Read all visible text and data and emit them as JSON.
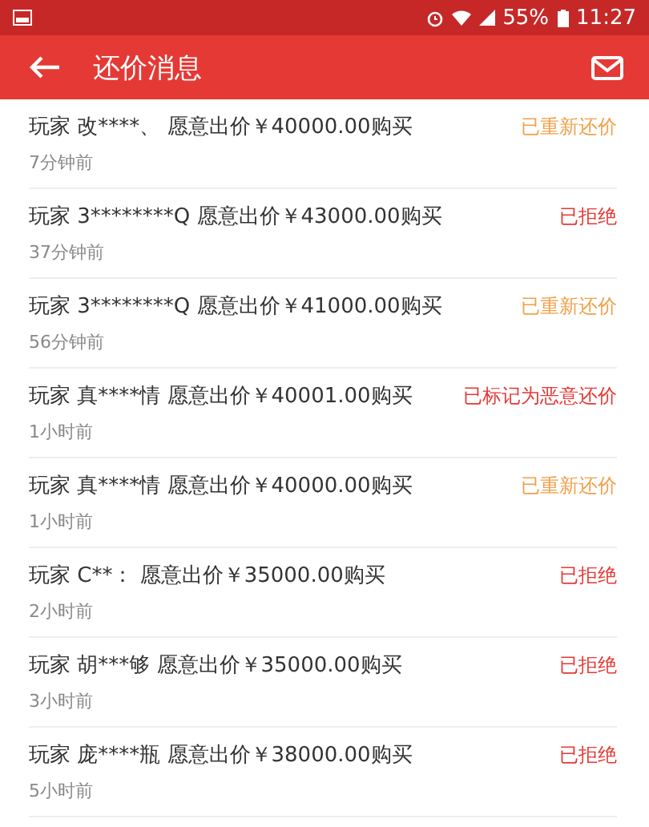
{
  "status_bar": {
    "battery": "55%",
    "time": "11:27"
  },
  "header": {
    "title": "还价消息"
  },
  "messages": [
    {
      "text": "玩家 改****、 愿意出价￥40000.00购买",
      "status": "已重新还价",
      "kind": "reoffered",
      "time": "7分钟前"
    },
    {
      "text": "玩家 3********Q 愿意出价￥43000.00购买",
      "status": "已拒绝",
      "kind": "rejected",
      "time": "37分钟前"
    },
    {
      "text": "玩家 3********Q 愿意出价￥41000.00购买",
      "status": "已重新还价",
      "kind": "reoffered",
      "time": "56分钟前"
    },
    {
      "text": "玩家 真****情 愿意出价￥40001.00购买",
      "status": "已标记为恶意还价",
      "kind": "malicious",
      "time": "1小时前"
    },
    {
      "text": "玩家 真****情 愿意出价￥40000.00购买",
      "status": "已重新还价",
      "kind": "reoffered",
      "time": "1小时前"
    },
    {
      "text": "玩家 C**： 愿意出价￥35000.00购买",
      "status": "已拒绝",
      "kind": "rejected",
      "time": "2小时前"
    },
    {
      "text": "玩家 胡***够 愿意出价￥35000.00购买",
      "status": "已拒绝",
      "kind": "rejected",
      "time": "3小时前"
    },
    {
      "text": "玩家 庞****瓶 愿意出价￥38000.00购买",
      "status": "已拒绝",
      "kind": "rejected",
      "time": "5小时前"
    }
  ]
}
